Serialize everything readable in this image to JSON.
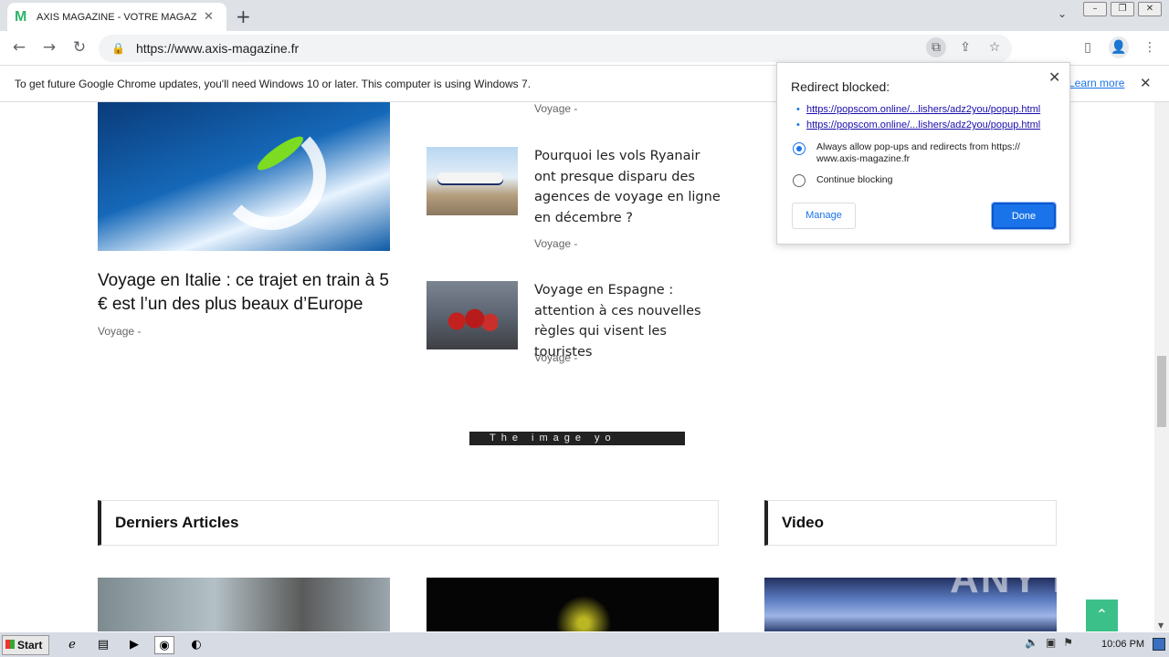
{
  "browser": {
    "tab_title": "AXIS MAGAZINE - VOTRE MAGAZINE",
    "favicon_letter": "M",
    "url": "https://www.axis-magazine.fr"
  },
  "infobar": {
    "message": "To get future Google Chrome updates, you'll need Windows 10 or later. This computer is using Windows 7.",
    "learn_more": "Learn more"
  },
  "popup": {
    "title": "Redirect blocked:",
    "links": [
      "https://popscom.online/...lishers/adz2you/popup.html",
      "https://popscom.online/...lishers/adz2you/popup.html"
    ],
    "option_allow": "Always allow pop-ups and redirects from https:// www.axis-magazine.fr",
    "option_block": "Continue blocking",
    "manage_label": "Manage",
    "done_label": "Done"
  },
  "main": {
    "hero_title": "Voyage en Italie : ce trajet en train à 5 € est l’un des plus beaux d’Europe",
    "hero_meta": "Voyage -",
    "top_meta": "Voyage -",
    "articles": [
      {
        "title": "Pourquoi les vols Ryanair ont presque disparu des agences de voyage en ligne en décembre ?",
        "meta": "Voyage -"
      },
      {
        "title": "Voyage en Espagne : attention à ces nouvelles règles qui visent les touristes",
        "meta": "Voyage -"
      }
    ],
    "ad_text": "The image yo",
    "section_latest": "Derniers Articles",
    "section_video": "Video",
    "watermark": "ANY RUN"
  },
  "taskbar": {
    "start_label": "Start",
    "clock": "10:06 PM"
  }
}
